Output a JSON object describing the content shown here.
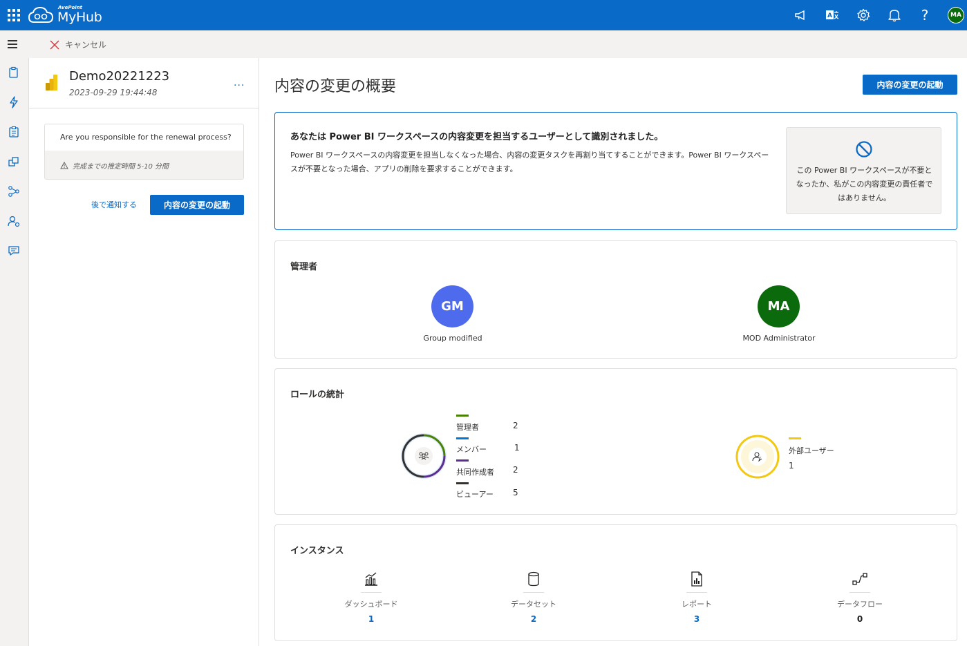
{
  "brand": {
    "small": "AvePoint",
    "name": "MyHub",
    "color": "#0a6ac7"
  },
  "topbar_icons": [
    "megaphone-icon",
    "translate-icon",
    "gear-icon",
    "bell-icon",
    "help-icon"
  ],
  "help_glyph": "?",
  "user_avatar": "MA",
  "commandbar": {
    "cancel_label": "キャンセル"
  },
  "leftnav_icons": [
    "clipboard-icon",
    "lightning-icon",
    "checklist-icon",
    "copy-icon",
    "network-icon",
    "user-settings-icon",
    "chat-icon"
  ],
  "item": {
    "title": "Demo20221223",
    "date": "2023-09-29 19:44:48",
    "more": "...",
    "question": "Are you responsible for the renewal process?",
    "estimate": "完成までの推定時間 5-10 分間",
    "later_label": "後で通知する",
    "start_label": "内容の変更の起動"
  },
  "main": {
    "title": "内容の変更の概要",
    "start_label": "内容の変更の起動"
  },
  "notice": {
    "title": "あなたは Power BI ワークスペースの内容変更を担当するユーザーとして識別されました。",
    "body": "Power BI ワークスペースの内容変更を担当しなくなった場合、内容の変更タスクを再割り当てすることができます。Power BI ワークスペースが不要となった場合、アプリの削除を要求することができます。",
    "decline": "この Power BI ワークスペースが不要となったか、私がこの内容変更の責任者ではありません。"
  },
  "admins": {
    "heading": "管理者",
    "people": [
      {
        "initials": "GM",
        "name": "Group modified",
        "color": "#4f6bed"
      },
      {
        "initials": "MA",
        "name": "MOD Administrator",
        "color": "#0b6a0b"
      }
    ]
  },
  "roles": {
    "heading": "ロールの統計",
    "items": [
      {
        "label": "管理者",
        "value": "2",
        "color": "#498205"
      },
      {
        "label": "メンバー",
        "value": "1",
        "color": "#0078d4"
      },
      {
        "label": "共同作成者",
        "value": "2",
        "color": "#5c2e91"
      },
      {
        "label": "ビューアー",
        "value": "5",
        "color": "#323130"
      }
    ],
    "external": {
      "label": "外部ユーザー",
      "value": "1",
      "color": "#f2c811"
    }
  },
  "instances": {
    "heading": "インスタンス",
    "items": [
      {
        "label": "ダッシュボード",
        "value": "1",
        "icon": "dashboard-icon",
        "color": "#0a6ac7"
      },
      {
        "label": "データセット",
        "value": "2",
        "icon": "dataset-icon",
        "color": "#0a6ac7"
      },
      {
        "label": "レポート",
        "value": "3",
        "icon": "report-icon",
        "color": "#0a6ac7"
      },
      {
        "label": "データフロー",
        "value": "0",
        "icon": "dataflow-icon",
        "color": "#201f1e"
      }
    ]
  }
}
